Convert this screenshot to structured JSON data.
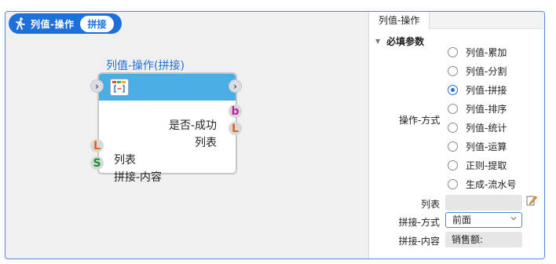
{
  "header": {
    "title": "列值-操作",
    "badge": "拼接"
  },
  "node": {
    "title": "列值-操作(拼接)",
    "outputs": [
      {
        "label": "是否-成功",
        "port": "b"
      },
      {
        "label": "列表",
        "port": "L"
      }
    ],
    "inputs": [
      {
        "label": "列表",
        "port": "L"
      },
      {
        "label": "拼接-内容",
        "port": "S"
      }
    ]
  },
  "panel": {
    "tab": "列值-操作",
    "section": "必填参数",
    "operation_label": "操作-方式",
    "options": [
      {
        "label": "列值-累加",
        "checked": false
      },
      {
        "label": "列值-分割",
        "checked": false
      },
      {
        "label": "列值-拼接",
        "checked": true
      },
      {
        "label": "列值-排序",
        "checked": false
      },
      {
        "label": "列值-统计",
        "checked": false
      },
      {
        "label": "列值-运算",
        "checked": false
      },
      {
        "label": "正则-提取",
        "checked": false
      },
      {
        "label": "生成-流水号",
        "checked": false
      }
    ],
    "list_label": "列表",
    "list_value": "",
    "join_mode_label": "拼接-方式",
    "join_mode_value": "前面",
    "join_content_label": "拼接-内容",
    "join_content_value": "销售额:"
  },
  "colors": {
    "accent": "#1e6fd9",
    "node_header": "#4aaee4",
    "port_b": "#c21ea8",
    "port_L": "#e0651a",
    "port_S": "#1f8c3a"
  }
}
